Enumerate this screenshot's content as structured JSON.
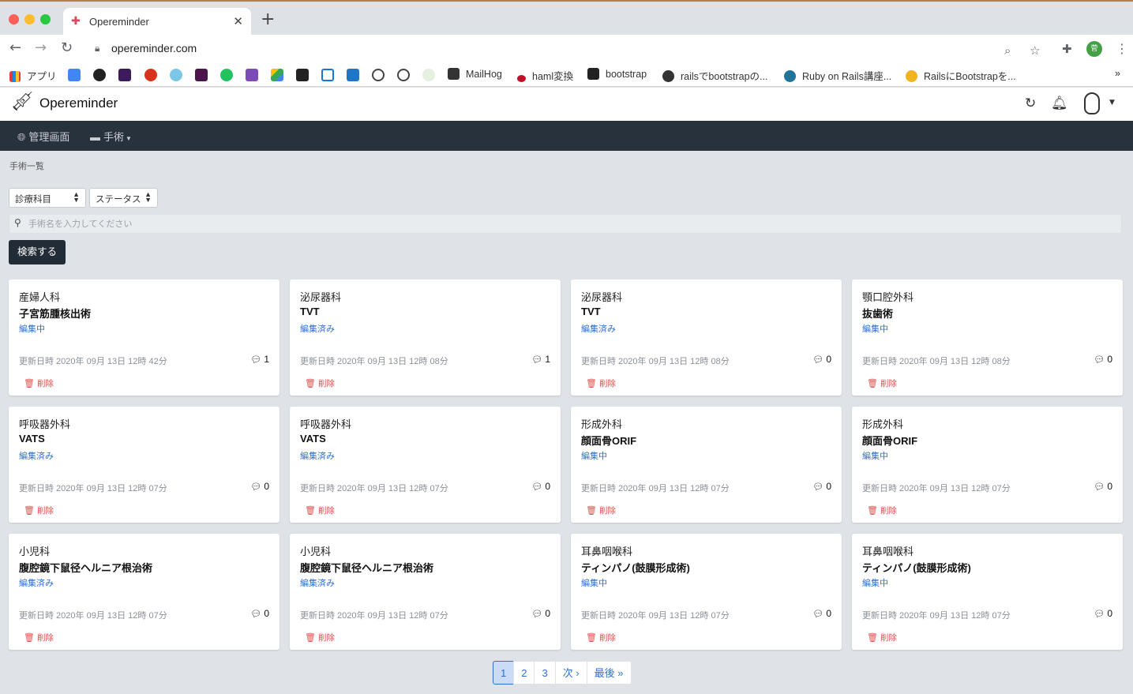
{
  "browser": {
    "tab_title": "Operemind‌er",
    "new_tab": "+",
    "url": "opereminder.com",
    "profile_initial": "菅",
    "bookmarks": {
      "apps": "アプリ",
      "mailhog": "MailHog",
      "haml": "haml変換",
      "bootstrap": "bootstrap",
      "rails_bootstrap": "railsでbootstrapの...",
      "ruby_rails": "Ruby on Rails講座...",
      "rails_bootstrap2": "RailsにBootstrapを...",
      "more": "»"
    }
  },
  "app": {
    "title": "Opereminder",
    "nav": {
      "admin": "管理画面",
      "surgery": "手術"
    },
    "breadcrumb": "手術一覧",
    "filters": {
      "department": "診療科目",
      "status": "ステータス"
    },
    "search": {
      "placeholder": "手術名を入力してください",
      "button": "検索する"
    },
    "delete_label": "削除",
    "cards": [
      {
        "dept": "産婦人科",
        "name": "子宮筋腫核出術",
        "status": "編集中",
        "updated": "更新日時 2020年 09月 13日 12時 42分",
        "comments": "1"
      },
      {
        "dept": "泌尿器科",
        "name": "TVT",
        "status": "編集済み",
        "updated": "更新日時 2020年 09月 13日 12時 08分",
        "comments": "1"
      },
      {
        "dept": "泌尿器科",
        "name": "TVT",
        "status": "編集済み",
        "updated": "更新日時 2020年 09月 13日 12時 08分",
        "comments": "0"
      },
      {
        "dept": "顎口腔外科",
        "name": "抜歯術",
        "status": "編集中",
        "updated": "更新日時 2020年 09月 13日 12時 08分",
        "comments": "0"
      },
      {
        "dept": "呼吸器外科",
        "name": "VATS",
        "status": "編集済み",
        "updated": "更新日時 2020年 09月 13日 12時 07分",
        "comments": "0"
      },
      {
        "dept": "呼吸器外科",
        "name": "VATS",
        "status": "編集済み",
        "updated": "更新日時 2020年 09月 13日 12時 07分",
        "comments": "0"
      },
      {
        "dept": "形成外科",
        "name": "顔面骨ORIF",
        "status": "編集中",
        "updated": "更新日時 2020年 09月 13日 12時 07分",
        "comments": "0"
      },
      {
        "dept": "形成外科",
        "name": "顔面骨ORIF",
        "status": "編集中",
        "updated": "更新日時 2020年 09月 13日 12時 07分",
        "comments": "0"
      },
      {
        "dept": "小児科",
        "name": "腹腔鏡下鼠径ヘルニア根治術",
        "status": "編集済み",
        "updated": "更新日時 2020年 09月 13日 12時 07分",
        "comments": "0"
      },
      {
        "dept": "小児科",
        "name": "腹腔鏡下鼠径ヘルニア根治術",
        "status": "編集済み",
        "updated": "更新日時 2020年 09月 13日 12時 07分",
        "comments": "0"
      },
      {
        "dept": "耳鼻咽喉科",
        "name": "ティンパノ(鼓膜形成術)",
        "status": "編集中",
        "updated": "更新日時 2020年 09月 13日 12時 07分",
        "comments": "0"
      },
      {
        "dept": "耳鼻咽喉科",
        "name": "ティンパノ(鼓膜形成術)",
        "status": "編集中",
        "updated": "更新日時 2020年 09月 13日 12時 07分",
        "comments": "0"
      }
    ],
    "pagination": {
      "pages": [
        "1",
        "2",
        "3"
      ],
      "current": "1",
      "next": "次 ›",
      "last": "最後 »"
    }
  },
  "colors": {
    "nav_bg": "#28323d",
    "status_blue": "#2f6fd0",
    "delete_red": "#d9534f",
    "page_bg": "#dfe3e8"
  }
}
